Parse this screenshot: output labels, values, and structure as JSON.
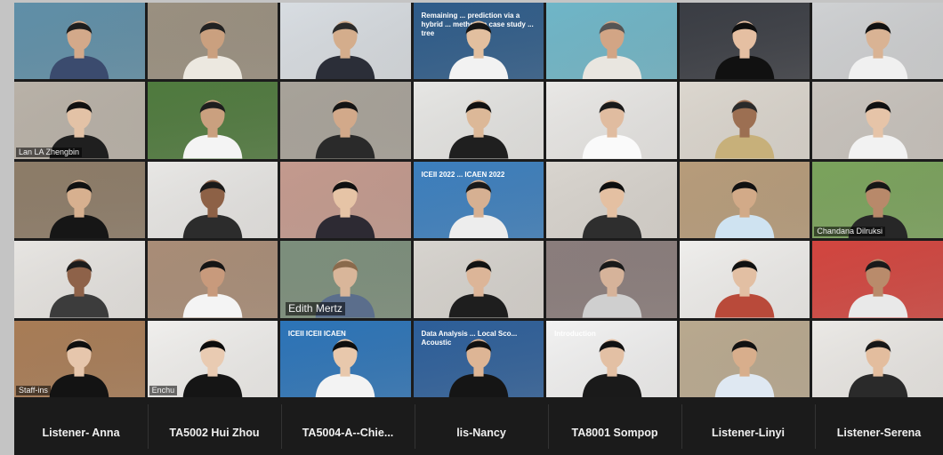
{
  "tiles": [
    {
      "label": "",
      "bg": "#5f8fa8",
      "skin": "#d3a98a",
      "shirt": "#3b4b6e",
      "hair": "#1e1e1e"
    },
    {
      "label": "",
      "bg": "#9a9080",
      "skin": "#caa07f",
      "shirt": "#ece8e0",
      "hair": "#222"
    },
    {
      "label": "",
      "bg": "#d8dde2",
      "skin": "#d4ad8c",
      "shirt": "#2b2e38",
      "hair": "#2a2a2a",
      "slide": true
    },
    {
      "label": "",
      "bg": "#2e5c8a",
      "skin": "#e2bf9f",
      "shirt": "#f2f2f2",
      "hair": "#151515",
      "slide_text": "Remaining ... prediction via a hybrid ... method: a case study ... tree"
    },
    {
      "label": "",
      "bg": "#6fb6c8",
      "skin": "#d2a585",
      "shirt": "#e9e6e0",
      "hair": "#555"
    },
    {
      "label": "",
      "bg": "#3a3d44",
      "skin": "#e5bfa2",
      "shirt": "#111",
      "hair": "#0e0e0e"
    },
    {
      "label": "",
      "bg": "#cfd1d3",
      "skin": "#d9b394",
      "shirt": "#f0f0f0",
      "hair": "#111"
    },
    {
      "label": "Lan LA Zhengbin",
      "bg": "#b9b2a8",
      "skin": "#e3c2a6",
      "shirt": "#1f1f1f",
      "hair": "#111"
    },
    {
      "label": "",
      "bg": "#4f7a3e",
      "skin": "#caa07f",
      "shirt": "#f4f4f4",
      "hair": "#1e1e1e"
    },
    {
      "label": "",
      "bg": "#a8a39a",
      "skin": "#d2a98a",
      "shirt": "#2a2a2a",
      "hair": "#141414"
    },
    {
      "label": "",
      "bg": "#e6e6e4",
      "skin": "#dcb898",
      "shirt": "#1f1f1f",
      "hair": "#111"
    },
    {
      "label": "",
      "bg": "#e9e8e6",
      "skin": "#e0bca0",
      "shirt": "#fafafa",
      "hair": "#1a1a1a"
    },
    {
      "label": "",
      "bg": "#dcd7cf",
      "skin": "#9c6f52",
      "shirt": "#c7b07a",
      "hair": "#2a2a2a"
    },
    {
      "label": "",
      "bg": "#c9c4be",
      "skin": "#e6c4a8",
      "shirt": "#f2f2f2",
      "hair": "#111"
    },
    {
      "label": "",
      "bg": "#8d7c68",
      "skin": "#d7b08f",
      "shirt": "#161616",
      "hair": "#111"
    },
    {
      "label": "",
      "bg": "#e8e7e5",
      "skin": "#8d6146",
      "shirt": "#2c2c2c",
      "hair": "#1a1a1a"
    },
    {
      "label": "",
      "bg": "#c49a8e",
      "skin": "#e6c4a6",
      "shirt": "#2d2a33",
      "hair": "#111"
    },
    {
      "label": "",
      "bg": "#3c7fbe",
      "skin": "#d6b092",
      "shirt": "#ededed",
      "hair": "#1a1a1a",
      "slide_text": "ICEII 2022 ... ICAEN 2022"
    },
    {
      "label": "",
      "bg": "#d9d5cf",
      "skin": "#e4c0a2",
      "shirt": "#2e2e2e",
      "hair": "#0f0f0f"
    },
    {
      "label": "",
      "bg": "#b79c7a",
      "skin": "#d2aa88",
      "shirt": "#cfe3f1",
      "hair": "#111"
    },
    {
      "label": "Chandana Dilruksi",
      "bg": "#7aa35c",
      "skin": "#b8896a",
      "shirt": "#272727",
      "hair": "#161616"
    },
    {
      "label": "",
      "bg": "#e7e5e2",
      "skin": "#8e6249",
      "shirt": "#3c3c3c",
      "hair": "#1c1c1c"
    },
    {
      "label": "",
      "bg": "#a98d77",
      "skin": "#c89a7c",
      "shirt": "#f4f4f4",
      "hair": "#151515"
    },
    {
      "label": "Edith Mertz",
      "bg": "#7c8f7c",
      "skin": "#d9b69a",
      "shirt": "#5b6e8c",
      "hair": "#8a6a4c",
      "big": true
    },
    {
      "label": "",
      "bg": "#d7d4cf",
      "skin": "#dcb598",
      "shirt": "#1e1e1e",
      "hair": "#121212"
    },
    {
      "label": "",
      "bg": "#8a7d7c",
      "skin": "#d6b39a",
      "shirt": "#cfcfcf",
      "hair": "#191919"
    },
    {
      "label": "",
      "bg": "#efeeec",
      "skin": "#e2bfa3",
      "shirt": "#b94a3a",
      "hair": "#111"
    },
    {
      "label": "",
      "bg": "#d2453f",
      "skin": "#b98b6b",
      "shirt": "#e9e9e9",
      "hair": "#1a1a1a"
    },
    {
      "label": "Staff-ins",
      "bg": "#a87c56",
      "skin": "#e6c6ac",
      "shirt": "#131313",
      "hair": "#0f0f0f"
    },
    {
      "label": "Enchu",
      "bg": "#f0efed",
      "skin": "#e9cbb2",
      "shirt": "#151515",
      "hair": "#0c0c0c"
    },
    {
      "label": "",
      "bg": "#2c74b8",
      "skin": "#e8c8ac",
      "shirt": "#f3f3f3",
      "hair": "#0e0e0e",
      "slide_text": "ICEII ICEII ICAEN"
    },
    {
      "label": "",
      "bg": "#2d5f9a",
      "skin": "#ddb595",
      "shirt": "#151515",
      "hair": "#111",
      "slide_text": "Data Analysis ... Local Sco... Acoustic"
    },
    {
      "label": "",
      "bg": "#f2f2f2",
      "skin": "#e3c0a4",
      "shirt": "#1a1a1a",
      "hair": "#111",
      "slide_text": "Introduction"
    },
    {
      "label": "",
      "bg": "#b9a98f",
      "skin": "#d8ae8c",
      "shirt": "#dfe8f2",
      "hair": "#121212"
    },
    {
      "label": "",
      "bg": "#ebe9e6",
      "skin": "#e3bd9e",
      "shirt": "#2a2a2a",
      "hair": "#171717"
    }
  ],
  "names": [
    "Listener- Anna",
    "TA5002 Hui Zhou",
    "TA5004-A--Chie...",
    "lis-Nancy",
    "TA8001 Sompop",
    "Listener-Linyi",
    "Listener-Serena"
  ]
}
